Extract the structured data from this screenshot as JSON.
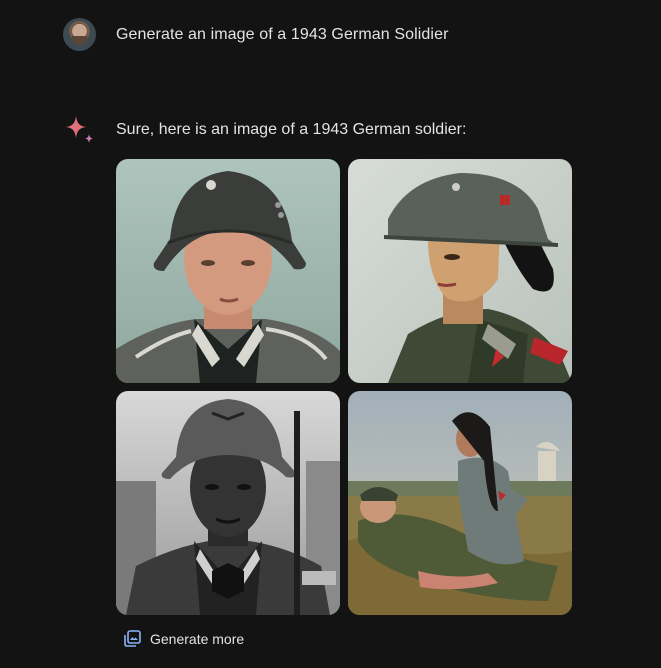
{
  "user_prompt": {
    "text": "Generate an image of a 1943 German Solidier"
  },
  "response": {
    "intro": "Sure, here is an image of a 1943 German soldier:",
    "sparkle_colors": [
      "#d96570",
      "#9b72cb"
    ],
    "images": [
      {
        "subject": "soldier-portrait-1"
      },
      {
        "subject": "soldier-portrait-2"
      },
      {
        "subject": "soldier-portrait-3"
      },
      {
        "subject": "soldier-portrait-4"
      }
    ],
    "generate_more_label": "Generate more"
  }
}
